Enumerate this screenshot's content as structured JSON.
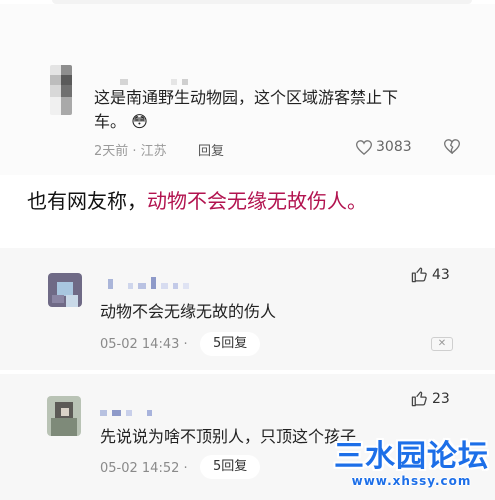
{
  "comment_top": {
    "text_line1": "这是南通野生动物园，这个区域游客禁止下",
    "text_line2": "车。",
    "emoji": "😳",
    "time_location": "2天前 · 江苏",
    "reply_label": "回复",
    "like_count": "3083"
  },
  "headline": {
    "prefix": "也有网友称，",
    "highlight": "动物不会无缘无故伤人。"
  },
  "replies": [
    {
      "text": "动物不会无缘无故的伤人",
      "date": "05-02 14:43 ·",
      "reply_btn": "5回复",
      "like_count": "43"
    },
    {
      "text": "先说说为啥不顶别人，只顶这个孩子",
      "date": "05-02 14:52 ·",
      "reply_btn": "5回复",
      "like_count": "23"
    }
  ],
  "watermark": {
    "main": "三水园论坛",
    "sub": "www.xhssy.com"
  },
  "colors": {
    "highlight": "#b2134f",
    "watermark": "#1d6fe8"
  }
}
